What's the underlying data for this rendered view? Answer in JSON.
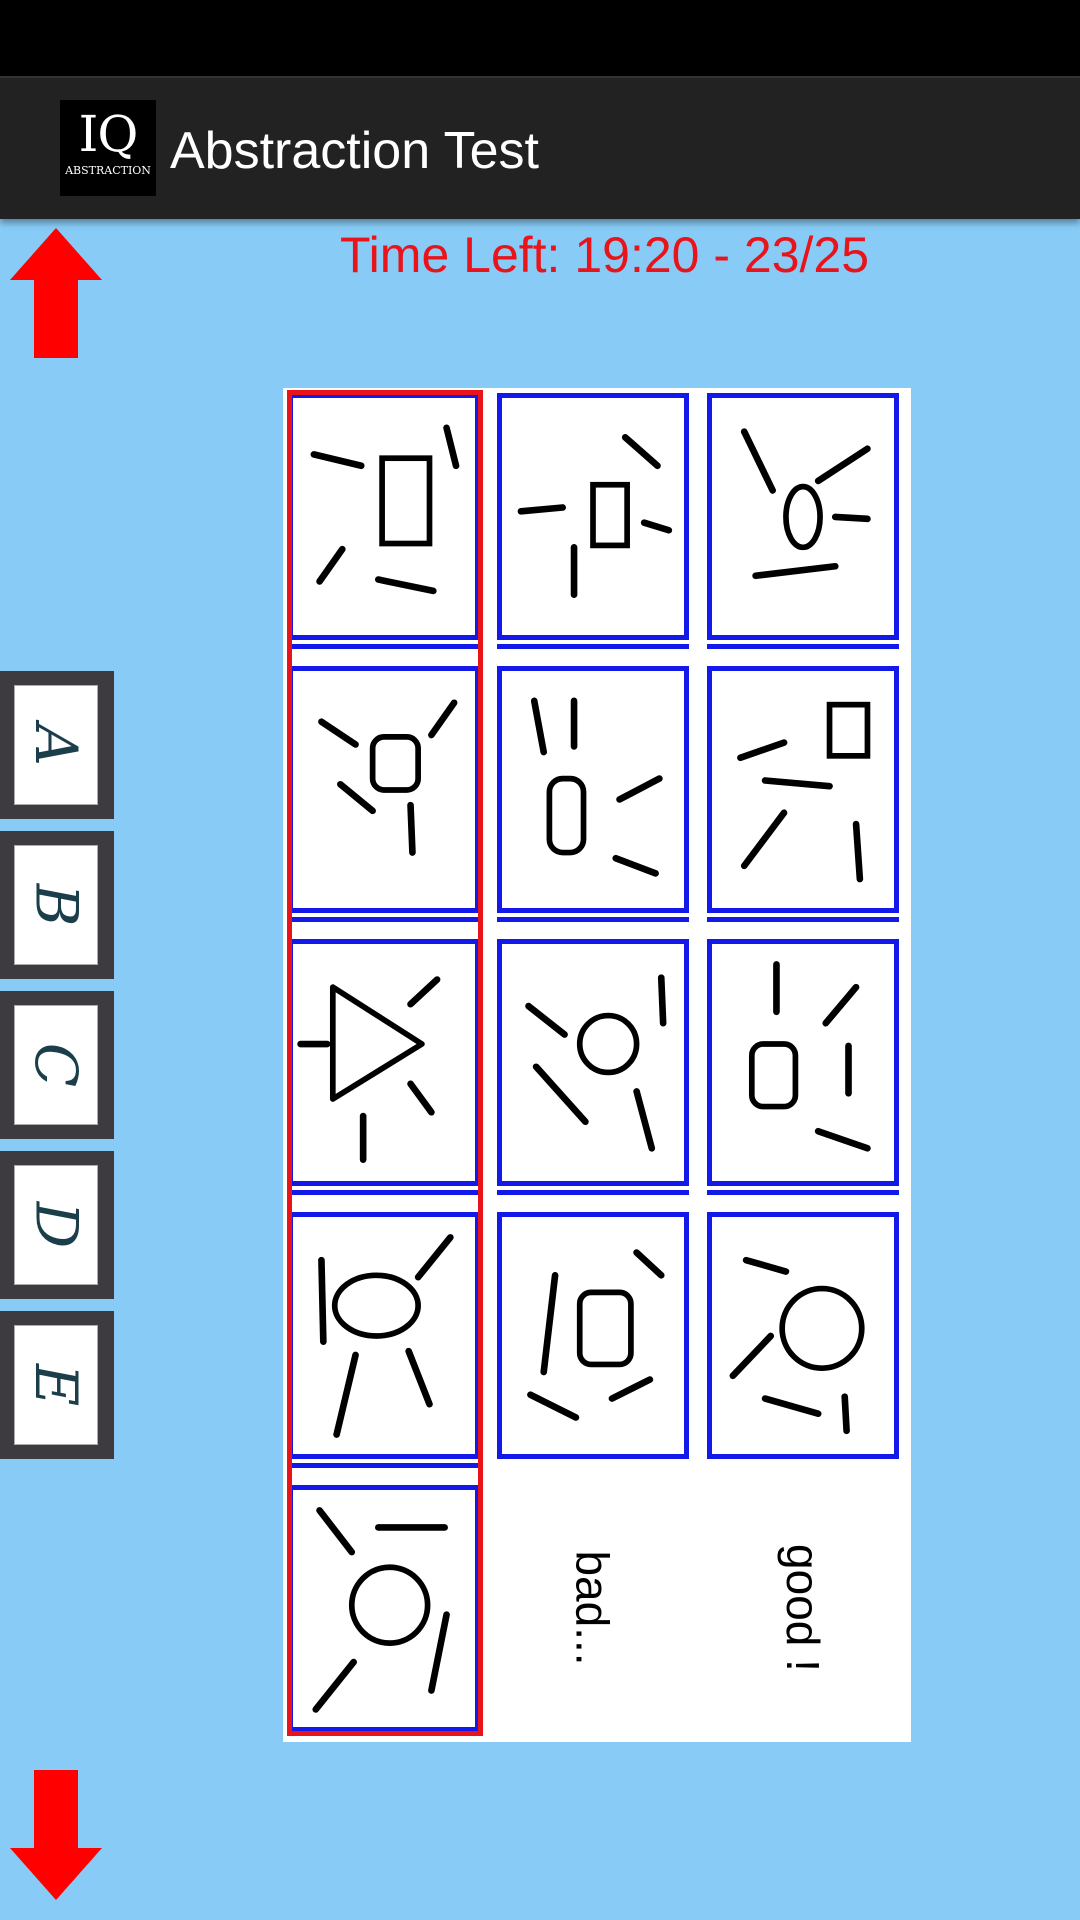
{
  "status_bar": {},
  "app_bar": {
    "icon_text": "IQ",
    "icon_subtext": "ABSTRACTION",
    "title": "Abstraction Test"
  },
  "timer": {
    "text": "Time Left: 19:20 - 23/25"
  },
  "colors": {
    "background": "#87CBF6",
    "action_bar": "#222222",
    "timer_text": "#E8141A",
    "cell_border": "#1219E8",
    "selected_border": "#E8141A",
    "arrow": "#FF0000",
    "answer_button": "#3D3A40"
  },
  "navigation": {
    "up_icon": "arrow-up-icon",
    "down_icon": "arrow-down-icon"
  },
  "answers": {
    "options": [
      {
        "id": "A",
        "label": "A"
      },
      {
        "id": "B",
        "label": "B"
      },
      {
        "id": "C",
        "label": "C"
      },
      {
        "id": "D",
        "label": "D"
      },
      {
        "id": "E",
        "label": "E"
      }
    ]
  },
  "puzzle": {
    "selected_column": 1,
    "columns": [
      {
        "figures": [
          "rectangle-with-lines",
          "rounded-square-with-lines",
          "triangle-with-lines",
          "ellipse-with-lines",
          "circle-with-lines"
        ]
      },
      {
        "figures": [
          "small-rectangle-with-lines",
          "tall-oval-with-lines",
          "circle-with-lines",
          "rounded-rectangle-with-lines"
        ]
      },
      {
        "figures": [
          "oval-with-lines",
          "square-with-lines",
          "rounded-rectangle-with-lines",
          "circle-with-lines"
        ]
      }
    ],
    "feedback_bad": "bad...",
    "feedback_good": "good !"
  }
}
